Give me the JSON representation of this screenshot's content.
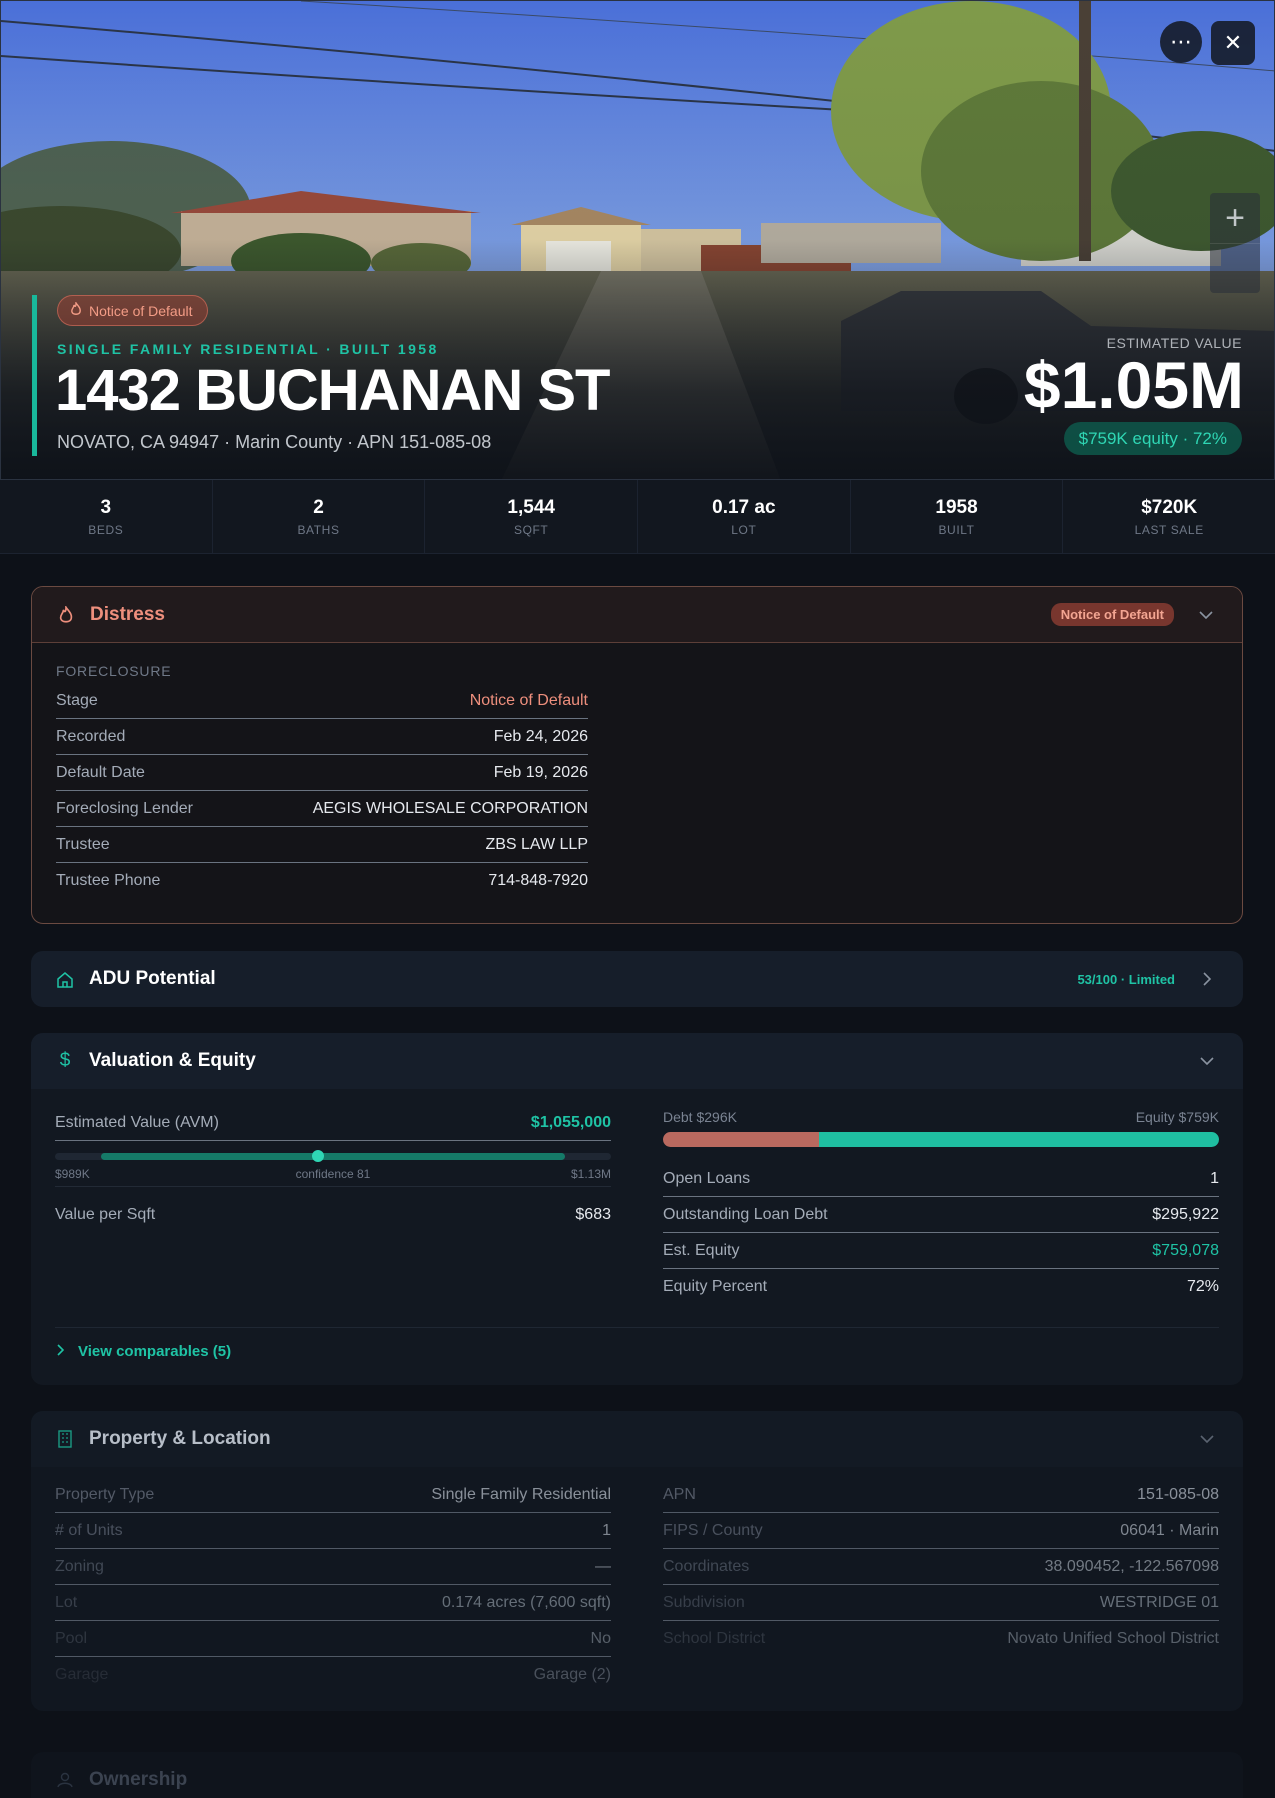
{
  "hero": {
    "badge": "Notice of Default",
    "subtitle": "SINGLE FAMILY RESIDENTIAL · BUILT 1958",
    "title": "1432 BUCHANAN ST",
    "address": "NOVATO, CA 94947 · Marin County · APN 151-085-08",
    "est_label": "ESTIMATED VALUE",
    "est_value": "$1.05M",
    "equity_pill": "$759K equity · 72%",
    "buttons": {
      "more_icon": "ellipsis-icon",
      "close_icon": "close-icon",
      "zoom_in": "+",
      "zoom_out": ""
    }
  },
  "stats": [
    {
      "value": "3",
      "label": "BEDS"
    },
    {
      "value": "2",
      "label": "BATHS"
    },
    {
      "value": "1,544",
      "label": "SQFT"
    },
    {
      "value": "0.17 ac",
      "label": "LOT"
    },
    {
      "value": "1958",
      "label": "BUILT"
    },
    {
      "value": "$720K",
      "label": "LAST SALE"
    }
  ],
  "distress": {
    "title": "Distress",
    "badge": "Notice of Default",
    "section": "FORECLOSURE",
    "rows": [
      {
        "k": "Stage",
        "v": "Notice of Default"
      },
      {
        "k": "Recorded",
        "v": "Feb 24, 2026"
      },
      {
        "k": "Default Date",
        "v": "Feb 19, 2026"
      },
      {
        "k": "Foreclosing Lender",
        "v": "AEGIS WHOLESALE CORPORATION"
      },
      {
        "k": "Trustee",
        "v": "ZBS LAW LLP"
      },
      {
        "k": "Trustee Phone",
        "v": "714-848-7920"
      }
    ]
  },
  "adu": {
    "title": "ADU Potential",
    "score": "53/100 · Limited"
  },
  "valuation": {
    "title": "Valuation & Equity",
    "avm_label": "Estimated Value (AVM)",
    "avm_value": "$1,055,000",
    "range_low": "$989K",
    "range_high": "$1.13M",
    "confidence": "confidence 81",
    "range_min": 989000,
    "range_max": 1130000,
    "avm_number": 1055000,
    "ppsf_label": "Value per Sqft",
    "ppsf_value": "$683",
    "debt_label": "Debt $296K",
    "equity_label": "Equity $759K",
    "debt_fraction": 0.28,
    "rows": [
      {
        "k": "Open Loans",
        "v": "1"
      },
      {
        "k": "Outstanding Loan Debt",
        "v": "$295,922"
      },
      {
        "k": "Est. Equity",
        "v": "$759,078"
      },
      {
        "k": "Equity Percent",
        "v": "72%"
      }
    ],
    "comparables": "View comparables (5)"
  },
  "property": {
    "title": "Property & Location",
    "left": [
      {
        "k": "Property Type",
        "v": "Single Family Residential"
      },
      {
        "k": "# of Units",
        "v": "1"
      },
      {
        "k": "Zoning",
        "v": "—"
      },
      {
        "k": "Lot",
        "v": "0.174 acres (7,600 sqft)"
      },
      {
        "k": "Pool",
        "v": "No"
      },
      {
        "k": "Garage",
        "v": "Garage (2)"
      }
    ],
    "right": [
      {
        "k": "APN",
        "v": "151-085-08"
      },
      {
        "k": "FIPS / County",
        "v": "06041 · Marin"
      },
      {
        "k": "Coordinates",
        "v": "38.090452, -122.567098"
      },
      {
        "k": "Subdivision",
        "v": "WESTRIDGE 01"
      },
      {
        "k": "School District",
        "v": "Novato Unified School District"
      }
    ]
  },
  "ownership": {
    "title": "Ownership"
  },
  "colors": {
    "accent": "#1fc3a5",
    "distress": "#ee8f7d",
    "debt": "#b9695f",
    "bg": "#0d1118"
  }
}
